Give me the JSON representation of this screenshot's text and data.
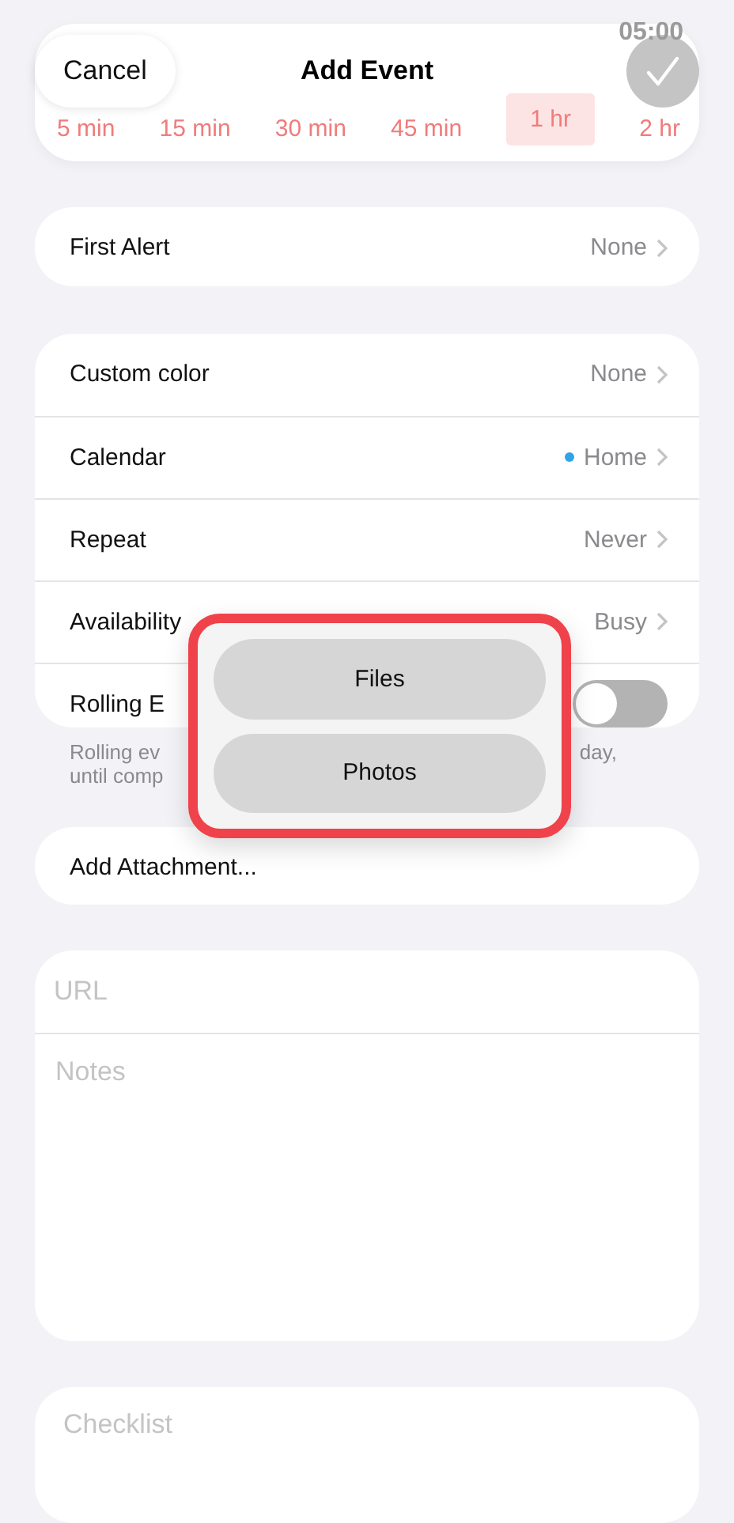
{
  "nav": {
    "cancel": "Cancel",
    "title": "Add Event",
    "background_time": "05:00"
  },
  "durations": [
    {
      "label": "5 min",
      "selected": false
    },
    {
      "label": "15 min",
      "selected": false
    },
    {
      "label": "30 min",
      "selected": false
    },
    {
      "label": "45 min",
      "selected": false
    },
    {
      "label": "1 hr",
      "selected": true
    },
    {
      "label": "2 hr",
      "selected": false
    }
  ],
  "first_alert": {
    "label": "First Alert",
    "value": "None"
  },
  "settings": [
    {
      "kind": "link",
      "label": "Custom color",
      "value": "None"
    },
    {
      "kind": "link",
      "label": "Calendar",
      "value": "Home",
      "color": "#32a4e6"
    },
    {
      "kind": "link",
      "label": "Repeat",
      "value": "Never"
    },
    {
      "kind": "link",
      "label": "Availability",
      "value": "Busy"
    },
    {
      "kind": "toggle",
      "label": "Rolling E",
      "on": false
    }
  ],
  "footer": {
    "left": [
      "Rolling ev",
      "until comp"
    ],
    "right": "day,"
  },
  "attachment": {
    "label": "Add Attachment..."
  },
  "url": {
    "placeholder": "URL"
  },
  "notes": {
    "placeholder": "Notes"
  },
  "checklist": {
    "placeholder": "Checklist"
  },
  "popup": {
    "options": [
      "Files",
      "Photos"
    ]
  }
}
